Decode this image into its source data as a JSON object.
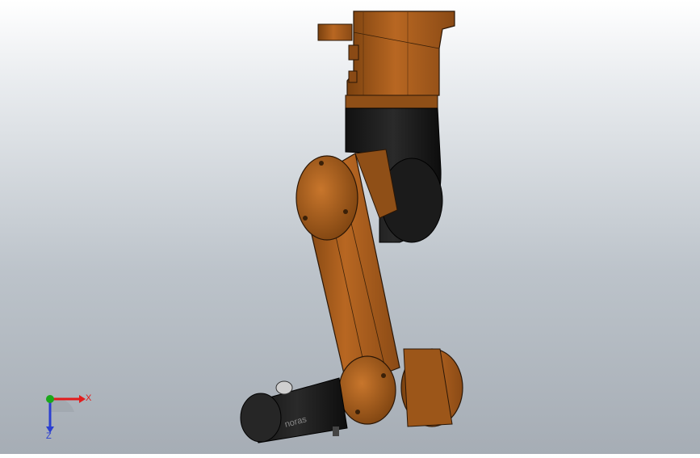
{
  "model": {
    "name": "robot-arm-assembly",
    "colors": {
      "orange": "#a85d1f",
      "orange_light": "#c9772e",
      "orange_dark": "#6e3a10",
      "black": "#1d1d1d",
      "black_light": "#3a3a3a",
      "edge": "#1a0f06"
    }
  },
  "triad": {
    "x_label": "X",
    "y_label": "Y",
    "z_label": "Z",
    "x_color": "#e21b1b",
    "y_color": "#1aa81a",
    "z_color": "#2b3fd1"
  },
  "tool_label": "noras"
}
